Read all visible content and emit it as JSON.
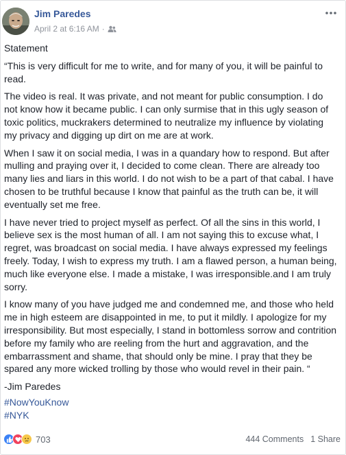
{
  "post": {
    "author": "Jim Paredes",
    "timestamp": "April 2 at 6:16 AM",
    "meta_separator": "·",
    "privacy_icon": "friends-icon",
    "paragraphs": [
      "Statement",
      "“This is very difficult for me to write, and for many of you, it will be painful to read.",
      "The video is real. It was private, and not meant for public consumption. I do not know how it became public. I can only surmise that in this ugly season of toxic politics, muckrakers determined to neutralize my influence by violating my privacy and digging up dirt on me are at work.",
      "When I saw it on social media, I was in a quandary how to respond. But after mulling and praying over it, I decided to come clean. There are already too many lies and liars in this world. I do not wish to be a part of that cabal. I have chosen to be truthful because I know that painful as the truth can be, it will eventually set me free.",
      "I have never tried to project myself as perfect. Of all the sins in this world, I believe sex is the most human of all. I am not saying this to excuse what, I regret, was broadcast on social media. I have always expressed my feelings freely. Today, I wish to express my truth. I am a flawed person, a human being, much like everyone else. I made a mistake, I was irresponsible.and I am truly sorry.",
      "I know many of you have judged me and condemned me, and those who held me in high esteem are disappointed in me, to put it mildly. I apologize for my irresponsibility. But most especially, I stand in bottomless sorrow and contrition before my family who are reeling from the hurt and aggravation, and the embarrassment and shame, that should only be mine. I pray that they be spared any more wicked trolling by those who would revel in their pain. “",
      "-Jim Paredes"
    ],
    "hashtags": [
      "#NowYouKnow",
      "#NYK"
    ]
  },
  "footer": {
    "reactions": [
      "like-icon",
      "love-icon",
      "sad-icon"
    ],
    "reaction_count": "703",
    "comments": "444 Comments",
    "shares": "1 Share"
  },
  "colors": {
    "link": "#365899",
    "meta": "#90949c",
    "text": "#1d2129",
    "like": "#3b82f6",
    "love": "#f0425e",
    "sad": "#f7c84a"
  }
}
